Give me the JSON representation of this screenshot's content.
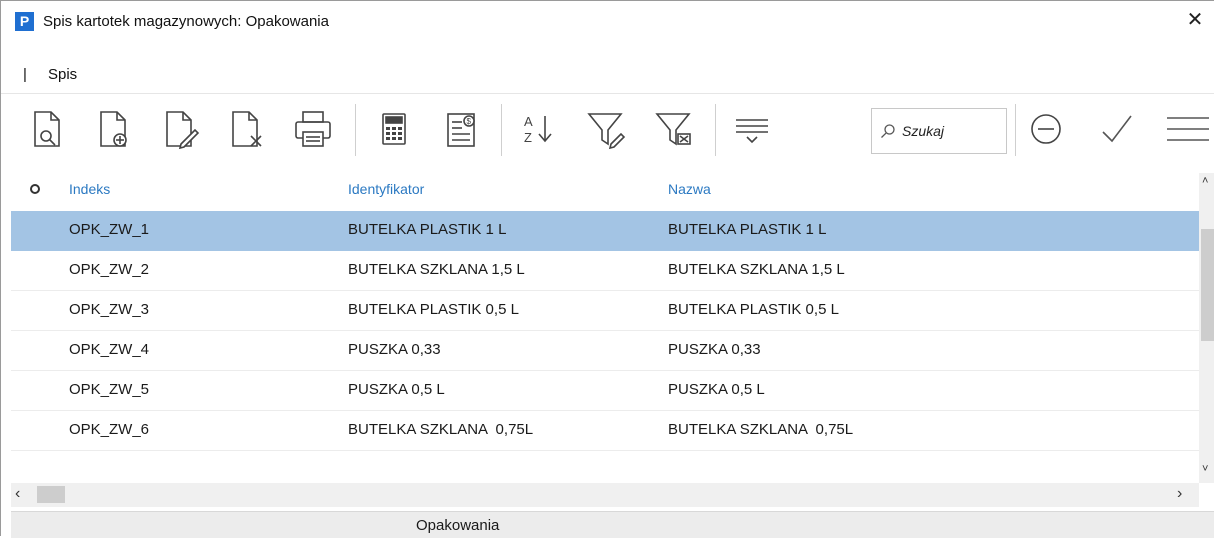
{
  "window": {
    "app_icon_letter": "P",
    "title": "Spis kartotek magazynowych: Opakowania",
    "close_glyph": "✕"
  },
  "menubar": {
    "separator": "|",
    "items": [
      {
        "label": "Spis"
      }
    ]
  },
  "toolbar": {
    "buttons": [
      {
        "name": "preview-document-icon"
      },
      {
        "name": "add-document-icon"
      },
      {
        "name": "edit-document-icon"
      },
      {
        "name": "delete-document-icon"
      },
      {
        "name": "print-icon"
      },
      {
        "name": "calculator-icon"
      },
      {
        "name": "price-list-icon"
      },
      {
        "name": "sort-az-icon"
      },
      {
        "name": "filter-edit-icon"
      },
      {
        "name": "filter-clear-icon"
      },
      {
        "name": "list-options-icon"
      },
      {
        "name": "cancel-circle-icon"
      },
      {
        "name": "confirm-check-icon"
      },
      {
        "name": "hamburger-menu-icon"
      }
    ],
    "search": {
      "placeholder": "Szukaj",
      "value": ""
    }
  },
  "table": {
    "columns": [
      "Indeks",
      "Identyfikator",
      "Nazwa"
    ],
    "selected_row": 0,
    "rows": [
      {
        "indeks": "OPK_ZW_1",
        "identyfikator": "BUTELKA PLASTIK 1 L",
        "nazwa": "BUTELKA PLASTIK 1 L"
      },
      {
        "indeks": "OPK_ZW_2",
        "identyfikator": "BUTELKA SZKLANA 1,5 L",
        "nazwa": "BUTELKA SZKLANA 1,5 L"
      },
      {
        "indeks": "OPK_ZW_3",
        "identyfikator": "BUTELKA PLASTIK 0,5 L",
        "nazwa": "BUTELKA PLASTIK 0,5 L"
      },
      {
        "indeks": "OPK_ZW_4",
        "identyfikator": "PUSZKA 0,33",
        "nazwa": "PUSZKA 0,33"
      },
      {
        "indeks": "OPK_ZW_5",
        "identyfikator": "PUSZKA 0,5 L",
        "nazwa": "PUSZKA 0,5 L"
      },
      {
        "indeks": "OPK_ZW_6",
        "identyfikator": "BUTELKA SZKLANA  0,75L",
        "nazwa": "BUTELKA SZKLANA  0,75L"
      }
    ]
  },
  "statusbar": {
    "text": "Opakowania"
  },
  "colors": {
    "accent": "#2b79c2",
    "selection": "#a3c4e4",
    "app_icon": "#1f6fd1"
  }
}
